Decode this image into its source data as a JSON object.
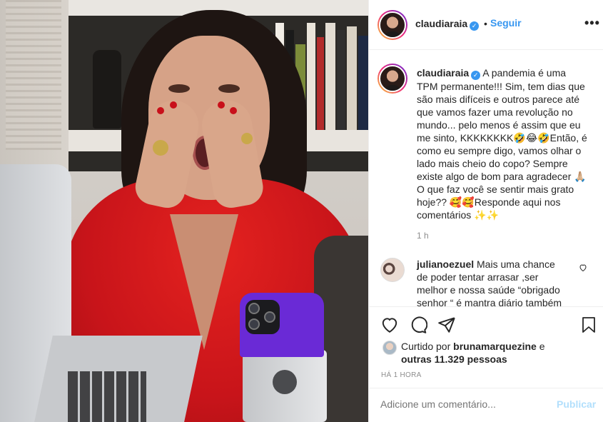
{
  "post": {
    "username": "claudiaraia",
    "verified_symbol": "✓",
    "follow_separator": "•",
    "follow_label": "Seguir",
    "more_label": "•••"
  },
  "caption": {
    "username": "claudiaraia",
    "text": "A pandemia é uma TPM permanente!!! Sim, tem dias que são mais difíceis e outros parece até que vamos fazer uma revolução no mundo... pelo menos é assim que eu me sinto, KKKKKKKK🤣😂🤣Então, é como eu sempre digo, vamos olhar o lado mais cheio do copo? Sempre existe algo de bom para agradecer 🙏🏼 O que faz você se sentir mais grato hoje?? 🥰🥰Responde aqui nos comentários ✨✨",
    "time": "1 h"
  },
  "comments": [
    {
      "username": "julianoezuel",
      "text": "Mais uma chance de poder tentar arrasar ,ser melhor e nossa saúde “obrigado senhor “ é mantra diário também"
    }
  ],
  "likes": {
    "prefix": "Curtido por",
    "user": "brunamarquezine",
    "conjunction": "e",
    "others": "outras 11.329 pessoas"
  },
  "timestamp": "HÁ 1 HORA",
  "add_comment": {
    "placeholder": "Adicione um comentário...",
    "publish_label": "Publicar"
  },
  "colors": {
    "link_blue": "#3897f0",
    "publish_disabled": "#b2dffc",
    "muted": "#8e8e8e",
    "dress_red": "#d0171c",
    "phone_purple": "#6a2ad6"
  },
  "icons": [
    "heart-icon",
    "comment-icon",
    "share-icon",
    "bookmark-icon",
    "more-icon",
    "verified-icon"
  ]
}
